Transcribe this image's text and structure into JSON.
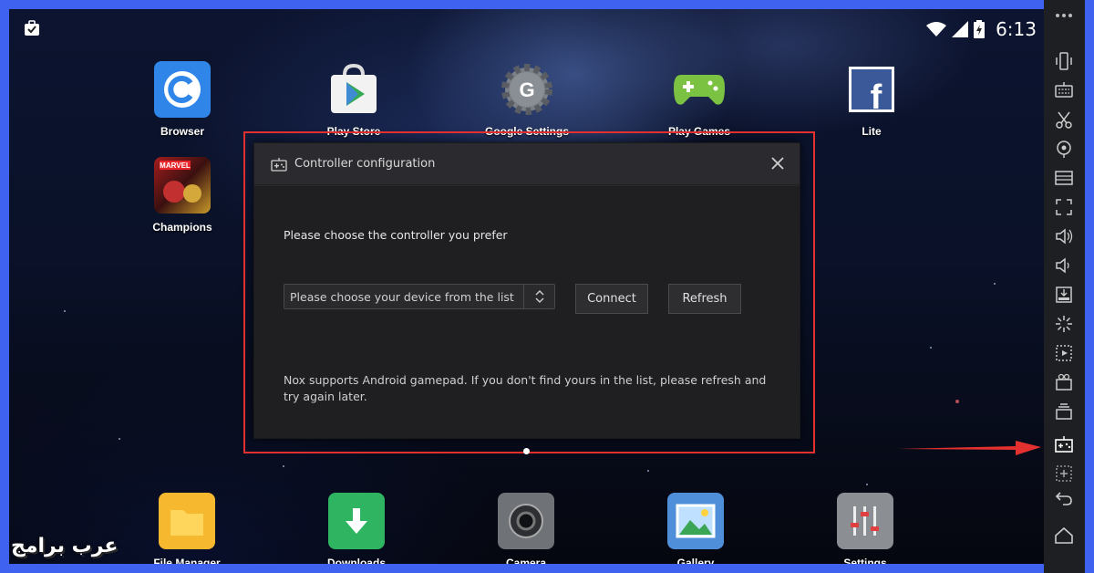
{
  "status_bar": {
    "time": "6:13",
    "icons": [
      "briefcase-check-icon",
      "wifi-icon",
      "signal-icon",
      "battery-icon"
    ]
  },
  "home_apps": [
    {
      "label": "Browser",
      "icon": "browser-icon"
    },
    {
      "label": "Play Store",
      "icon": "play-store-icon"
    },
    {
      "label": "Google Settings",
      "icon": "google-settings-icon"
    },
    {
      "label": "Play Games",
      "icon": "play-games-icon"
    },
    {
      "label": "Lite",
      "icon": "facebook-lite-icon"
    },
    {
      "label": "Champions",
      "icon": "marvel-champions-icon"
    }
  ],
  "dock_apps": [
    {
      "label": "File Manager",
      "icon": "folder-icon"
    },
    {
      "label": "Downloads",
      "icon": "download-icon"
    },
    {
      "label": "Camera",
      "icon": "camera-icon"
    },
    {
      "label": "Gallery",
      "icon": "gallery-icon"
    },
    {
      "label": "Settings",
      "icon": "settings-sliders-icon"
    }
  ],
  "dialog": {
    "title": "Controller configuration",
    "prompt": "Please choose the controller you prefer",
    "device_select": {
      "value": "Please choose your device from the list"
    },
    "connect_label": "Connect",
    "refresh_label": "Refresh",
    "note": "Nox supports Android gamepad. If you don't find yours in the list, please refresh and try again later."
  },
  "sidebar_icons": [
    "more-icon",
    "shake-icon",
    "keyboard-icon",
    "screenshot-scissors-icon",
    "location-icon",
    "toolbar-icon",
    "fullscreen-icon",
    "volume-up-icon",
    "volume-down-icon",
    "apk-icon",
    "loading-icon",
    "macro-icon",
    "video-record-icon",
    "multi-instance-icon",
    "controller-config-icon",
    "add-icon",
    "back-icon",
    "home-icon"
  ],
  "watermark": "عرب برامج",
  "colors": {
    "frame": "#3f63f0",
    "highlight": "#e53030",
    "arrow": "#e53030"
  }
}
